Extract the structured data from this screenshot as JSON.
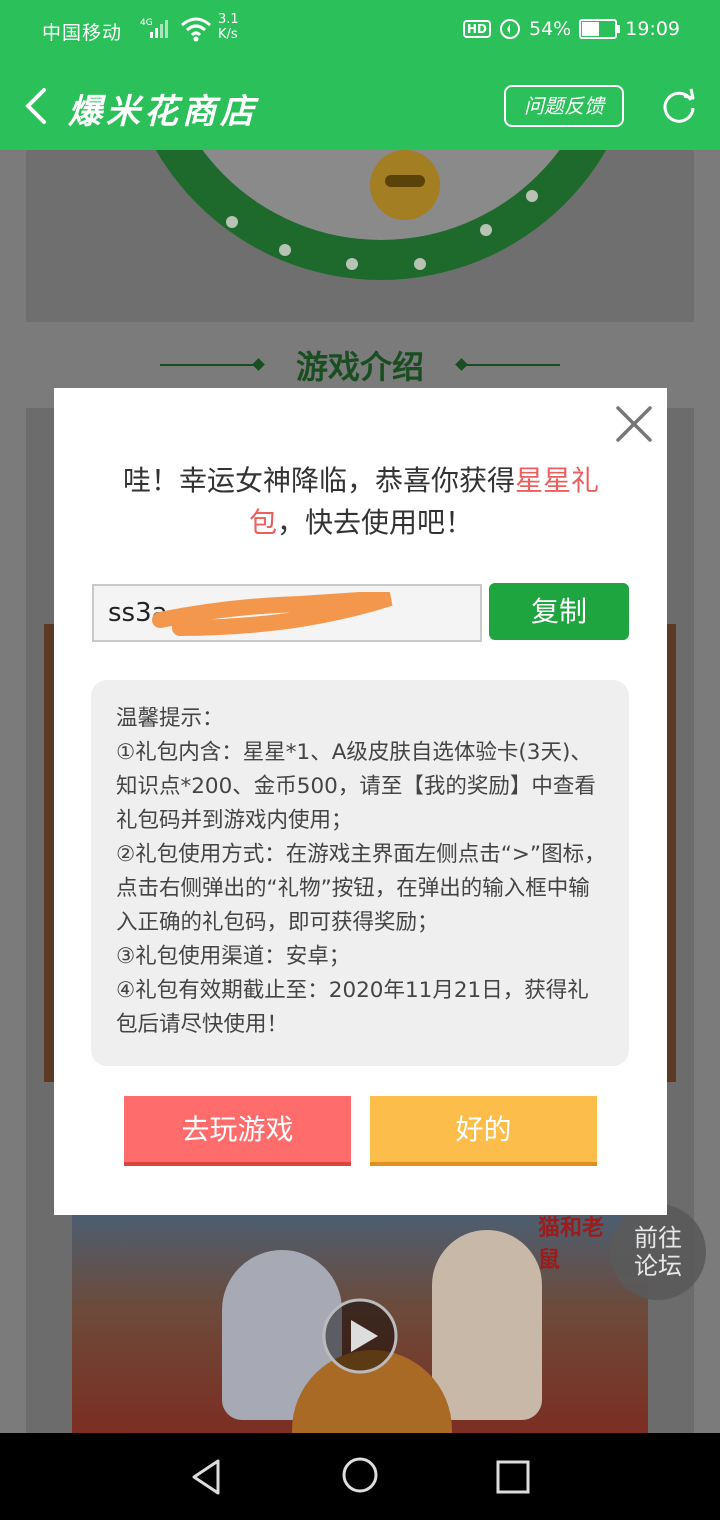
{
  "status_bar": {
    "carrier": "中国移动",
    "network": "4G",
    "speed_value": "3.1",
    "speed_unit": "K/s",
    "hd": "HD",
    "battery": "54%",
    "battery_level": 0.54,
    "time": "19:09"
  },
  "header": {
    "title": "爆米花商店",
    "feedback_label": "问题反馈",
    "back_icon": "chevron-left-icon",
    "refresh_icon": "refresh-icon"
  },
  "background": {
    "section_title": "游戏介绍",
    "video_logo": "猫和老鼠",
    "forum_button": [
      "前往",
      "论坛"
    ]
  },
  "dialog": {
    "message_prefix": "哇！幸运女神降临，恭喜你获得",
    "message_highlight": "星星礼包",
    "message_suffix": "，快去使用吧！",
    "code_value": "ss3a",
    "copy_label": "复制",
    "tips": [
      "温馨提示：",
      "①礼包内含：星星*1、A级皮肤自选体验卡(3天)、知识点*200、金币500，请至【我的奖励】中查看礼包码并到游戏内使用；",
      "②礼包使用方式：在游戏主界面左侧点击“>”图标，点击右侧弹出的“礼物”按钮，在弹出的输入框中输入正确的礼包码，即可获得奖励；",
      "③礼包使用渠道：安卓；",
      "④礼包有效期截止至：2020年11月21日，获得礼包后请尽快使用！"
    ],
    "play_button": "去玩游戏",
    "ok_button": "好的"
  },
  "colors": {
    "header_green": "#2cc05a",
    "copy_green": "#1ea53f",
    "highlight_red": "#ec5f5f",
    "play_red": "#ff6c6c",
    "ok_yellow": "#fdbd4a"
  }
}
